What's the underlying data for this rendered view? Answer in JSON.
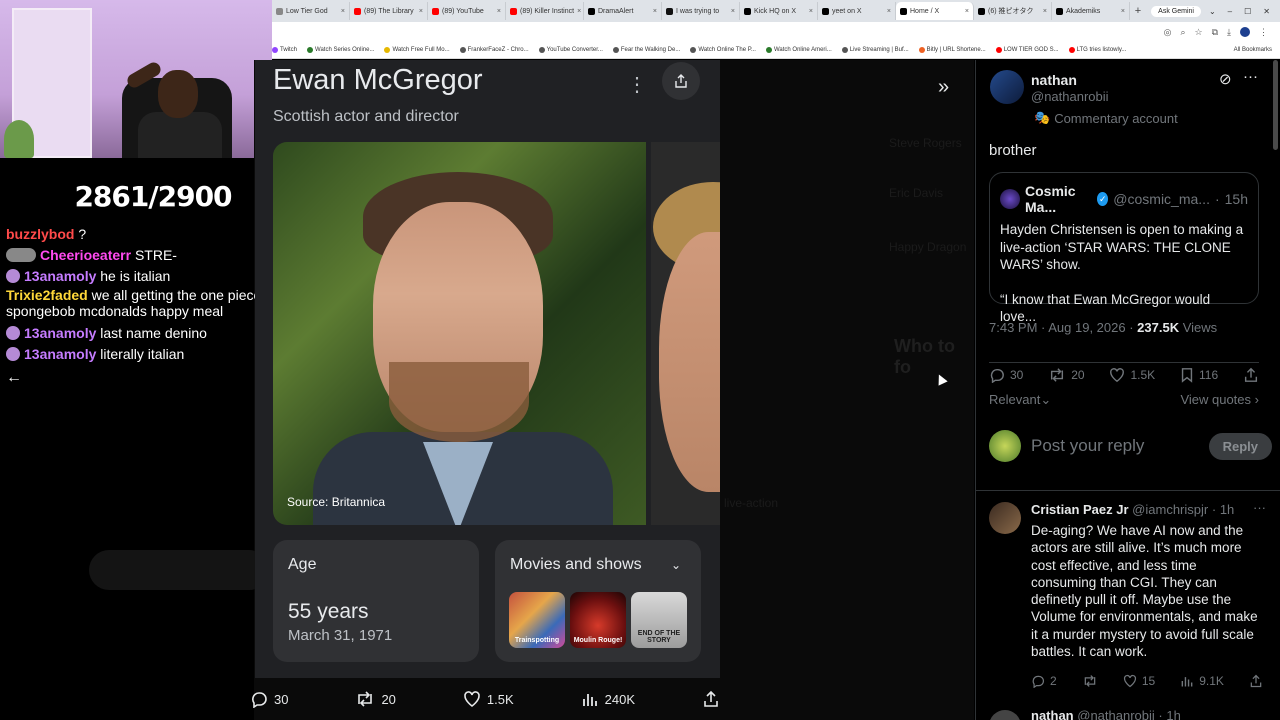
{
  "browser": {
    "tabs": [
      {
        "label": "Low Tier God",
        "color": "#888888"
      },
      {
        "label": "(89) The Library",
        "color": "#ff0000"
      },
      {
        "label": "(89) YouTube",
        "color": "#ff0000"
      },
      {
        "label": "(89) Killer Instinct",
        "color": "#ff0000"
      },
      {
        "label": "DramaAlert",
        "color": "#000000"
      },
      {
        "label": "I was trying to",
        "color": "#111111"
      },
      {
        "label": "Kick HQ on X",
        "color": "#000000"
      },
      {
        "label": "yeet on X",
        "color": "#000000"
      },
      {
        "label": "Home / X",
        "color": "#000000",
        "active": true
      },
      {
        "label": "(6) 推ピオタク",
        "color": "#000000"
      },
      {
        "label": "Akademiks",
        "color": "#000000"
      }
    ],
    "gemini_label": "Ask Gemini",
    "bookmarks": [
      {
        "label": "Twitch",
        "color": "#9146ff"
      },
      {
        "label": "Watch Series Online...",
        "color": "#2a7a2a"
      },
      {
        "label": "Watch Free Full Mo...",
        "color": "#e6b800"
      },
      {
        "label": "FrankerFaceZ - Chro...",
        "color": "#555555"
      },
      {
        "label": "YouTube Converter...",
        "color": "#555555"
      },
      {
        "label": "Fear the Walking De...",
        "color": "#555555"
      },
      {
        "label": "Watch Online The P...",
        "color": "#555555"
      },
      {
        "label": "Watch Online Ameri...",
        "color": "#2a7a2a"
      },
      {
        "label": "Live Streaming | Buf...",
        "color": "#555555"
      },
      {
        "label": "Bitly | URL Shortene...",
        "color": "#ee6123"
      },
      {
        "label": "LOW TIER GOD S...",
        "color": "#ff0000"
      },
      {
        "label": "LTG tries listowly...",
        "color": "#ff0000"
      }
    ],
    "all_bookmarks": "All Bookmarks"
  },
  "stream": {
    "counter": "2861/2900",
    "chat": [
      {
        "user": "buzzlybod",
        "color": "#ff4a4a",
        "text": "?",
        "badges": 0
      },
      {
        "user": "Cheerioeaterr",
        "color": "#ff4af0",
        "text": "STRE-",
        "badges": 2
      },
      {
        "user": "13anamoly",
        "color": "#c57cff",
        "text": "he is italian",
        "badges": 1
      },
      {
        "user": "Trixie2faded",
        "color": "#ffd83a",
        "text": "we all getting the one piece spongebob mcdonalds happy meal",
        "badges": 0
      },
      {
        "user": "13anamoly",
        "color": "#c57cff",
        "text": "last name denino",
        "badges": 1
      },
      {
        "user": "13anamoly",
        "color": "#c57cff",
        "text": "literally italian",
        "badges": 1
      }
    ]
  },
  "knowledge_panel": {
    "title": "Ewan McGregor",
    "subtitle": "Scottish actor and director",
    "photo_source": "Source: Britannica",
    "age_label": "Age",
    "age_value": "55 years",
    "birth_date": "March 31, 1971",
    "movies_label": "Movies and shows",
    "movie_thumbs": [
      "Trainspotting",
      "Moulin Rouge!",
      "END OF THE STORY"
    ]
  },
  "action_bar": {
    "replies": "30",
    "reposts": "20",
    "likes": "1.5K",
    "views": "240K"
  },
  "post": {
    "name": "nathan",
    "handle": "@nathanrobii",
    "tag": "Commentary account",
    "text": "brother",
    "quote": {
      "name": "Cosmic Ma...",
      "handle": "@cosmic_ma...",
      "time": "15h",
      "para1": "Hayden Christensen is open to making a live-action ‘STAR WARS: THE CLONE WARS’ show.",
      "para2": "“I know that Ewan McGregor would love..."
    },
    "timestamp": "7:43 PM · Aug 19, 2026 · ",
    "views_count": "237.5K",
    "views_label": " Views",
    "stats": {
      "replies": "30",
      "reposts": "20",
      "likes": "1.5K",
      "bookmarks": "116"
    },
    "sort_label": "Relevant",
    "view_quotes": "View quotes",
    "reply_placeholder": "Post your reply",
    "reply_button": "Reply"
  },
  "reply": {
    "name": "Cristian Paez Jr",
    "handle": "@iamchrispjr",
    "time": "1h",
    "text": "De-aging? We have AI now and the actors are still alive. It’s much more cost effective, and less time consuming than CGI. They can definetly pull it off. Maybe use the Volume for environmentals, and make it a murder mystery to avoid full scale battles. It can work.",
    "stats": {
      "replies": "2",
      "likes": "15",
      "views": "9.1K"
    }
  },
  "next_reply": {
    "name": "nathan",
    "handle": "@nathanrobii",
    "time": "1h"
  }
}
